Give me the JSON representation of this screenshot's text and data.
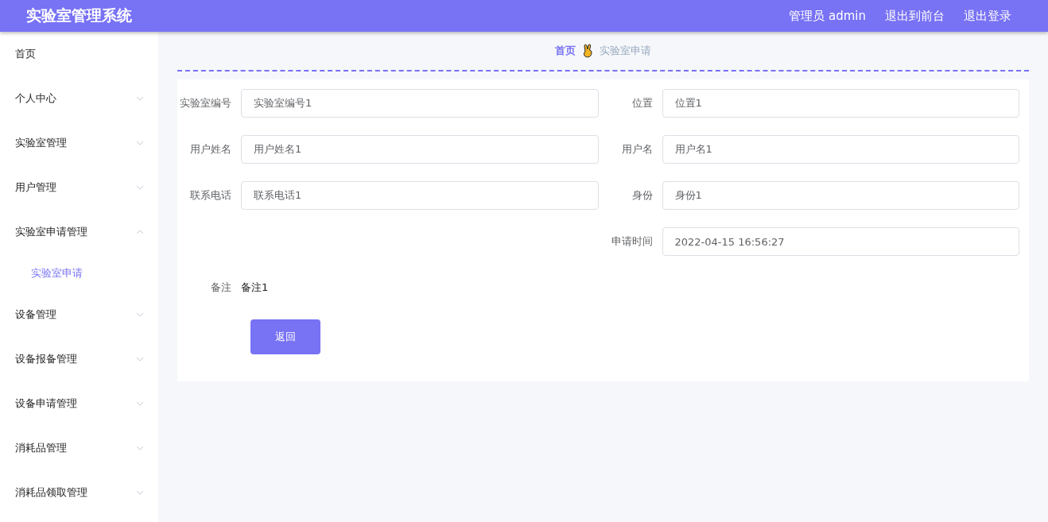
{
  "header": {
    "title": "实验室管理系统",
    "links": [
      "管理员 admin",
      "退出到前台",
      "退出登录"
    ]
  },
  "sidebar": {
    "items": [
      {
        "label": "首页",
        "selected": false
      },
      {
        "label": "个人中心",
        "selected": false,
        "expanded": false
      },
      {
        "label": "实验室管理",
        "selected": false,
        "expanded": false
      },
      {
        "label": "用户管理",
        "selected": false,
        "expanded": false
      },
      {
        "label": "实验室申请管理",
        "selected": false,
        "expanded": true,
        "children": [
          {
            "label": "实验室申请",
            "selected": true
          }
        ]
      },
      {
        "label": "设备管理",
        "selected": false,
        "expanded": false
      },
      {
        "label": "设备报备管理",
        "selected": false,
        "expanded": false
      },
      {
        "label": "设备申请管理",
        "selected": false,
        "expanded": false
      },
      {
        "label": "消耗品管理",
        "selected": false,
        "expanded": false
      },
      {
        "label": "消耗品领取管理",
        "selected": false,
        "expanded": false
      }
    ]
  },
  "breadcrumb": [
    "首页",
    "实验室申请"
  ],
  "form": {
    "left_column": [
      {
        "label": "实验室编号",
        "value": "实验室编号1"
      },
      {
        "label": "用户姓名",
        "value": "用户姓名1"
      },
      {
        "label": "联系电话",
        "value": "联系电话1"
      }
    ],
    "right_column": [
      {
        "label": "位置",
        "value": "位置1"
      },
      {
        "label": "用户名",
        "value": "用户名1"
      },
      {
        "label": "身份",
        "value": "身份1"
      },
      {
        "label": "申请时间",
        "value": "2022-04-15 16:56:27"
      }
    ],
    "remark": {
      "label": "备注",
      "value": "备注1"
    },
    "button": "返回"
  }
}
